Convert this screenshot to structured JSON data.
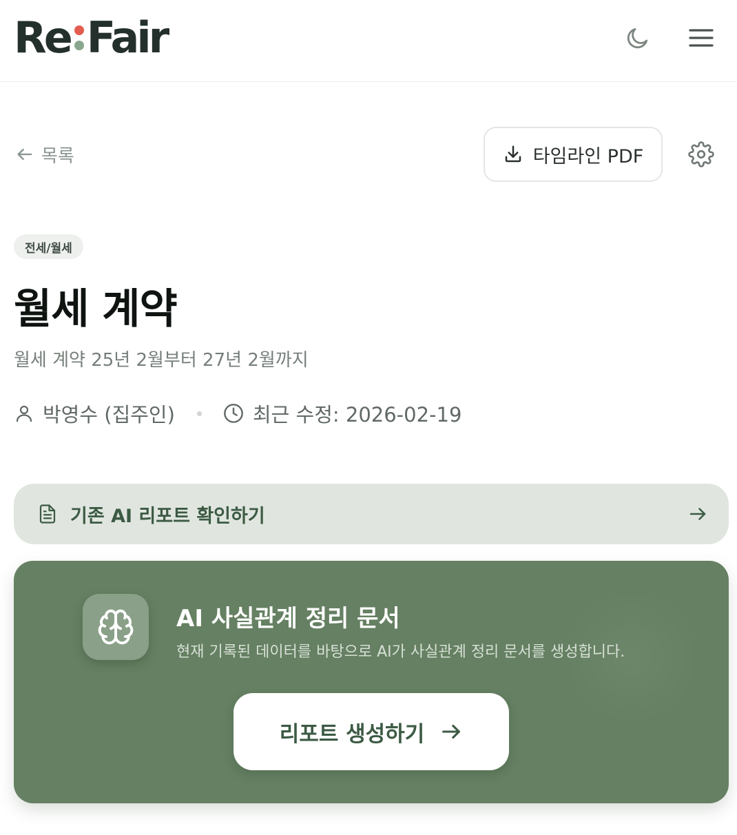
{
  "header": {
    "logo": {
      "left": "Re",
      "right": "Fair"
    },
    "theme_toggle_icon": "moon-icon",
    "menu_icon": "hamburger-menu-icon"
  },
  "toolbar": {
    "back_label": "목록",
    "pdf_button_label": "타임라인 PDF",
    "settings_icon": "gear-icon"
  },
  "contract": {
    "category": "전세/월세",
    "title": "월세 계약",
    "description": "월세 계약 25년 2월부터 27년 2월까지",
    "owner": "박영수 (집주인)",
    "updated": "최근 수정: 2026-02-19"
  },
  "existing_report": {
    "label": "기존 AI 리포트 확인하기"
  },
  "ai_card": {
    "title": "AI 사실관계 정리 문서",
    "description": "현재 기록된 데이터를 바탕으로 AI가 사실관계 정리 문서를 생성합니다.",
    "button_label": "리포트 생성하기"
  },
  "colors": {
    "brand_green": "#658062",
    "accent_red": "#e25c4f",
    "light_green_bg": "#e0e6df",
    "text_dark": "#0f1411"
  }
}
